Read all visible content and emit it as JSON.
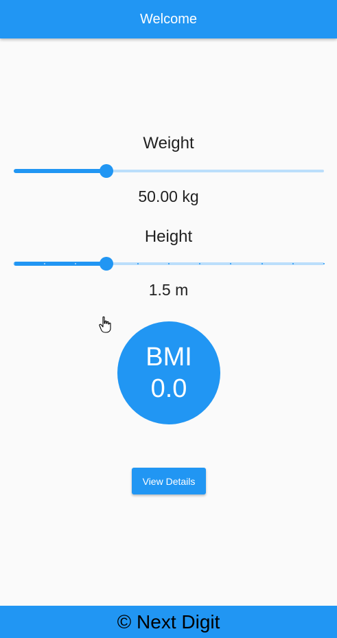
{
  "app_bar": {
    "title": "Welcome"
  },
  "weight": {
    "label": "Weight",
    "value_text": "50.00 kg",
    "slider_fraction": 0.299
  },
  "height": {
    "label": "Height",
    "value_text": "1.5 m",
    "slider_fraction": 0.299,
    "divisions": 10
  },
  "bmi": {
    "label": "BMI",
    "value": "0.0"
  },
  "actions": {
    "view_details_label": "View Details"
  },
  "footer": {
    "text": "© Next Digit"
  },
  "colors": {
    "primary": "#2196f3",
    "track_inactive": "#bbdefb",
    "background": "#fafafa",
    "text": "#212121"
  },
  "icons": {
    "cursor": "hand-pointer-icon"
  }
}
